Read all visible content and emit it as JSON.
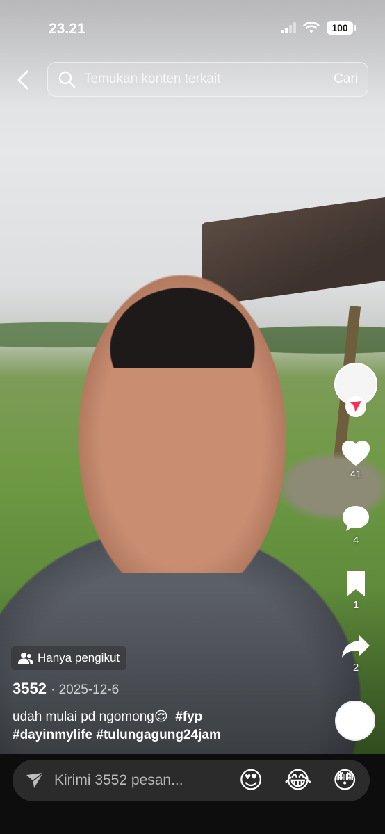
{
  "status_bar": {
    "time": "23.21",
    "battery": "100"
  },
  "search": {
    "placeholder": "Temukan konten terkait",
    "submit_label": "Cari"
  },
  "rail": {
    "likes": "41",
    "comments": "4",
    "saves": "1",
    "shares": "2"
  },
  "post": {
    "privacy_label": "Hanya pengikut",
    "author": "3552",
    "date": "· 2025-12-6",
    "caption_text": "udah mulai pd ngomong😌",
    "hashtags": [
      "#fyp",
      "#dayinmylife",
      "#tulungagung24jam"
    ]
  },
  "comment_bar": {
    "placeholder": "Kirimi 3552 pesan...",
    "quick_emojis": [
      "😍",
      "😂",
      "😳"
    ]
  },
  "colors": {
    "accent_red": "#fe2c55",
    "bar_bg": "#0d0d0d",
    "input_bg": "#2b2b2b"
  }
}
